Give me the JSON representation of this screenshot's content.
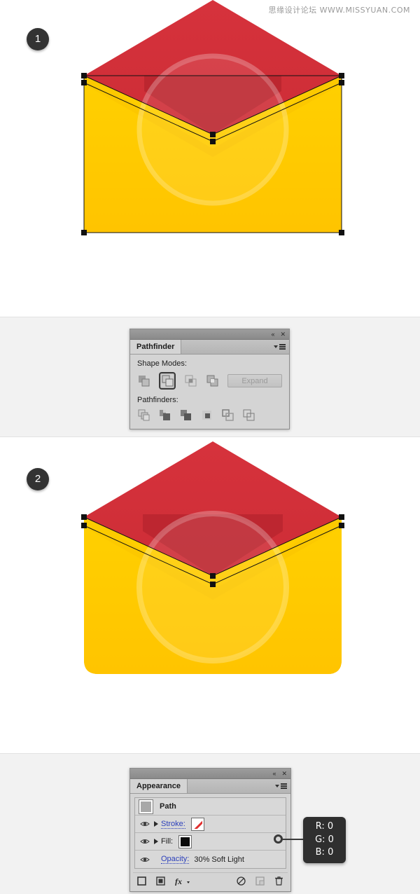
{
  "watermark": "思缘设计论坛  WWW.MISSYUAN.COM",
  "steps": [
    {
      "number": "1"
    },
    {
      "number": "2"
    }
  ],
  "artwork": {
    "name": "envelope-icon",
    "colors": {
      "envelope_body": "#FFC907",
      "envelope_body_shadow": "#F0B800",
      "flap_red": "#D3303A",
      "flap_red_dark": "#B5272F",
      "inner_chevron": "#C02A33",
      "circle_overlay": "#FFFFFF",
      "anchor_point": "#111111",
      "path_outline": "#1A1A1A"
    },
    "step1_caption": "",
    "step2_caption": ""
  },
  "pathfinder": {
    "title": "Pathfinder",
    "titlebar": {
      "collapse_icon": "«",
      "close_icon": "✕"
    },
    "menu_icon": "panel-menu-icon",
    "shape_modes_label": "Shape Modes:",
    "shape_modes": [
      {
        "name": "unite",
        "selected": false
      },
      {
        "name": "minus-front",
        "selected": true
      },
      {
        "name": "intersect",
        "selected": false
      },
      {
        "name": "exclude",
        "selected": false
      }
    ],
    "expand_label": "Expand",
    "expand_enabled": false,
    "pathfinders_label": "Pathfinders:",
    "pathfinders": [
      {
        "name": "divide"
      },
      {
        "name": "trim"
      },
      {
        "name": "merge"
      },
      {
        "name": "crop"
      },
      {
        "name": "outline"
      },
      {
        "name": "minus-back"
      }
    ]
  },
  "appearance": {
    "title": "Appearance",
    "titlebar": {
      "collapse_icon": "«",
      "close_icon": "✕"
    },
    "menu_icon": "panel-menu-icon",
    "object_label": "Path",
    "rows": [
      {
        "name": "stroke",
        "label": "Stroke:",
        "swatch": "none",
        "visible": true,
        "expandable": true
      },
      {
        "name": "fill",
        "label": "Fill:",
        "swatch": "black",
        "visible": true,
        "expandable": true
      }
    ],
    "opacity": {
      "label": "Opacity:",
      "value": "30% Soft Light",
      "visible": true
    },
    "toolbar": [
      {
        "name": "add-new-stroke"
      },
      {
        "name": "add-new-fill"
      },
      {
        "name": "add-new-effect"
      },
      {
        "name": "clear-appearance"
      },
      {
        "name": "duplicate-item"
      },
      {
        "name": "delete-item"
      }
    ]
  },
  "rgb_callout": {
    "r": "R: 0",
    "g": "G: 0",
    "b": "B: 0"
  }
}
